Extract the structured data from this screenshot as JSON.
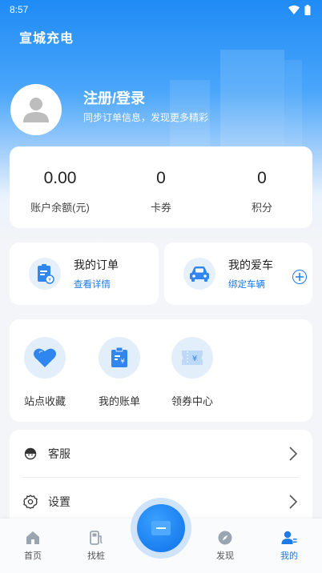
{
  "status_bar": {
    "time": "8:57"
  },
  "app": {
    "title": "宣城充电"
  },
  "profile": {
    "login_label": "注册/登录",
    "subtitle": "同步订单信息，发现更多精彩"
  },
  "stats": [
    {
      "value": "0.00",
      "label": "账户余额(元)"
    },
    {
      "value": "0",
      "label": "卡券"
    },
    {
      "value": "0",
      "label": "积分"
    }
  ],
  "quick": {
    "orders": {
      "title": "我的订单",
      "link": "查看详情"
    },
    "car": {
      "title": "我的爱车",
      "link": "绑定车辆"
    }
  },
  "tools": [
    {
      "label": "站点收藏",
      "icon": "heart-icon"
    },
    {
      "label": "我的账单",
      "icon": "bill-icon"
    },
    {
      "label": "领券中心",
      "icon": "coupon-icon"
    }
  ],
  "menu": [
    {
      "label": "客服",
      "icon": "customer-service-icon"
    },
    {
      "label": "设置",
      "icon": "settings-icon"
    }
  ],
  "tabbar": [
    {
      "label": "首页",
      "icon": "home-icon"
    },
    {
      "label": "找桩",
      "icon": "charger-icon"
    },
    {
      "label": "发现",
      "icon": "compass-icon"
    },
    {
      "label": "我的",
      "icon": "user-icon"
    }
  ],
  "colors": {
    "primary": "#1e7ae6",
    "header": "#1f8bf5",
    "icon_bg": "#e3eefb"
  }
}
